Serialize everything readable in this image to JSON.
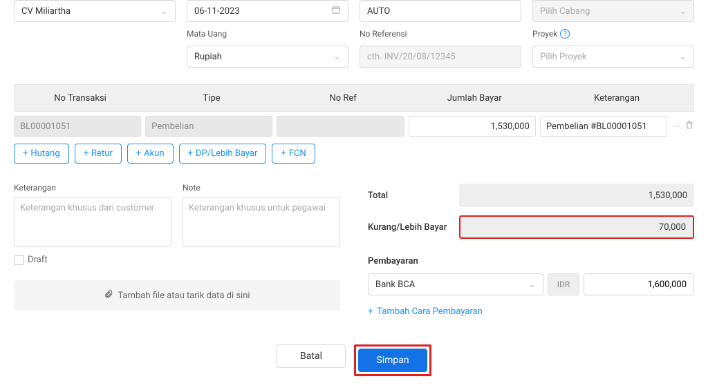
{
  "topRow1": {
    "vendor": "CV Miliartha",
    "date": "06-11-2023",
    "auto": "AUTO",
    "cabang_placeholder": "Pilih Cabang"
  },
  "topRow2": {
    "mata_uang_label": "Mata Uang",
    "mata_uang_value": "Rupiah",
    "no_ref_label": "No Referensi",
    "no_ref_placeholder": "cth. INV/20/08/12345",
    "proyek_label": "Proyek",
    "proyek_placeholder": "Pilih Proyek"
  },
  "table": {
    "headers": {
      "no_transaksi": "No Transaksi",
      "tipe": "Tipe",
      "no_ref": "No Ref",
      "jumlah_bayar": "Jumlah Bayar",
      "keterangan": "Keterangan"
    },
    "row": {
      "no_transaksi": "BL00001051",
      "tipe": "Pembelian",
      "no_ref": "",
      "jumlah_bayar": "1,530,000",
      "keterangan": "Pembelian #BL00001051"
    }
  },
  "pillButtons": {
    "hutang": "Hutang",
    "retur": "Retur",
    "akun": "Akun",
    "dp": "DP/Lebih Bayar",
    "fcn": "FCN"
  },
  "notes": {
    "keterangan_label": "Keterangan",
    "keterangan_placeholder": "Keterangan khusus dari customer",
    "note_label": "Note",
    "note_placeholder": "Keterangan khusus untuk pegawai",
    "draft_label": "Draft",
    "upload_label": "Tambah file atau tarik data di sini"
  },
  "summary": {
    "total_label": "Total",
    "total_value": "1,530,000",
    "kurang_label": "Kurang/Lebih Bayar",
    "kurang_value": "70,000",
    "pembayaran_label": "Pembayaran",
    "bank_value": "Bank BCA",
    "currency": "IDR",
    "amount": "1,600,000",
    "add_pay": "Tambah Cara Pembayaran"
  },
  "footer": {
    "batal": "Batal",
    "simpan": "Simpan"
  }
}
